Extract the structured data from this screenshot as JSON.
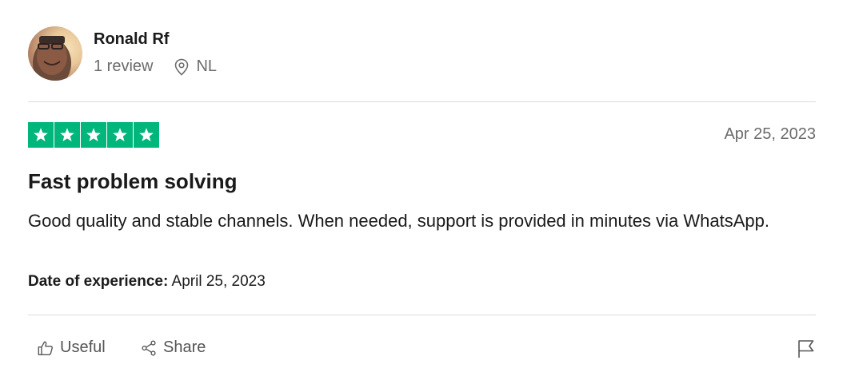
{
  "reviewer": {
    "name": "Ronald Rf",
    "review_count": "1 review",
    "country": "NL"
  },
  "review": {
    "rating": 5,
    "rating_max": 5,
    "date": "Apr 25, 2023",
    "title": "Fast problem solving",
    "body": "Good quality and stable channels. When needed, support is provided in minutes via WhatsApp.",
    "experience_label": "Date of experience:",
    "experience_date": "April 25, 2023"
  },
  "actions": {
    "useful_label": "Useful",
    "share_label": "Share"
  },
  "colors": {
    "star_green": "#00b67a",
    "muted_text": "#6b6b6b",
    "divider": "#dcdcdc"
  },
  "icons": [
    "location-pin-icon",
    "star-icon",
    "thumbs-up-icon",
    "share-icon",
    "flag-icon"
  ]
}
